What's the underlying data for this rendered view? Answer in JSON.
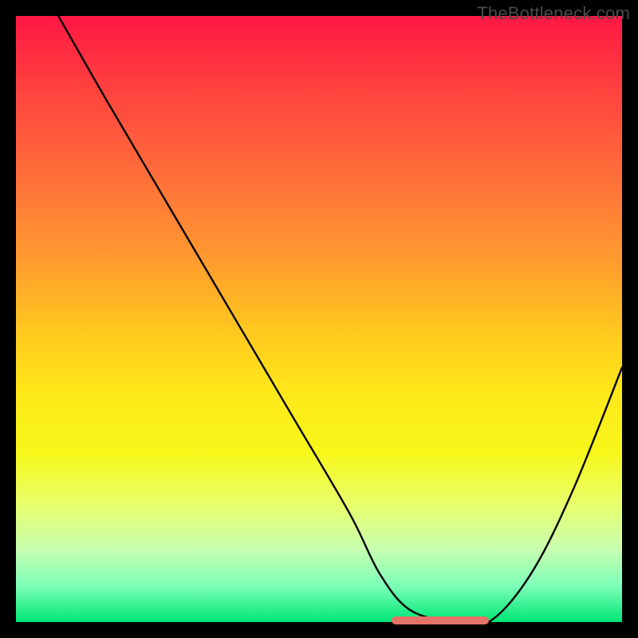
{
  "watermark": "TheBottleneck.com",
  "chart_data": {
    "type": "line",
    "title": "",
    "xlabel": "",
    "ylabel": "",
    "xlim": [
      0,
      100
    ],
    "ylim": [
      0,
      100
    ],
    "grid": false,
    "legend": false,
    "series": [
      {
        "name": "curve",
        "x": [
          7,
          15,
          25,
          35,
          45,
          55,
          60,
          65,
          72,
          78,
          85,
          92,
          100
        ],
        "y": [
          100,
          86,
          69,
          52,
          35,
          18,
          8,
          2,
          0,
          0,
          8,
          22,
          42
        ]
      }
    ],
    "optimal_range": {
      "x_start": 62,
      "x_end": 78,
      "y": 0
    },
    "marker_color": "#e57368",
    "curve_color": "#000000"
  }
}
